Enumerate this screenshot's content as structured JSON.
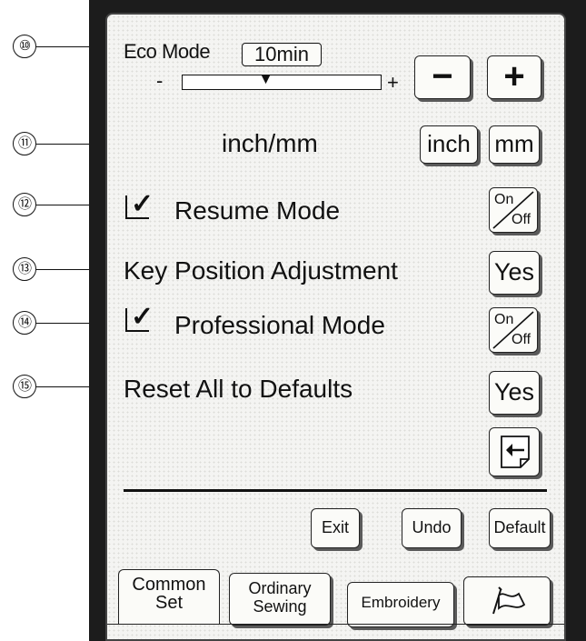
{
  "callouts": [
    "⑩",
    "⑪",
    "⑫",
    "⑬",
    "⑭",
    "⑮"
  ],
  "eco_mode": {
    "label": "Eco Mode",
    "value": "10min",
    "minus_sign": "-",
    "plus_sign": "+",
    "slider_level": 0.42,
    "decrease_label": "−",
    "increase_label": "+"
  },
  "units": {
    "label": "inch/mm",
    "inch_label": "inch",
    "mm_label": "mm"
  },
  "resume_mode": {
    "label": "Resume Mode",
    "checked": true,
    "toggle_on": "On",
    "toggle_off": "Off"
  },
  "key_position": {
    "label": "Key Position Adjustment",
    "button_label": "Yes"
  },
  "professional_mode": {
    "label": "Professional Mode",
    "checked": true,
    "toggle_on": "On",
    "toggle_off": "Off"
  },
  "reset_defaults": {
    "label": "Reset All to Defaults",
    "button_label": "Yes"
  },
  "footer": {
    "exit_label": "Exit",
    "undo_label": "Undo",
    "default_label": "Default"
  },
  "tabs": [
    {
      "line1": "Common",
      "line2": "Set",
      "active": true
    },
    {
      "line1": "Ordinary",
      "line2": "Sewing",
      "active": false
    },
    {
      "line1": "Embroidery",
      "line2": "",
      "active": false
    }
  ],
  "icons": {
    "save": "save-file-icon",
    "language": "flag-icon"
  }
}
